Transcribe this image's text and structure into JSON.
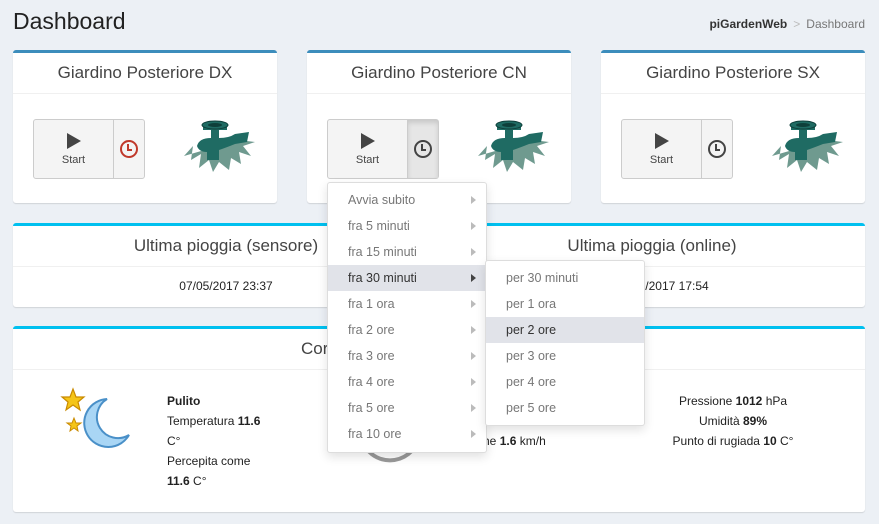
{
  "header": {
    "title": "Dashboard",
    "breadcrumb_home": "piGardenWeb",
    "breadcrumb_sep": ">",
    "breadcrumb_current": "Dashboard"
  },
  "zones": [
    {
      "title": "Giardino Posteriore DX",
      "start_label": "Start"
    },
    {
      "title": "Giardino Posteriore CN",
      "start_label": "Start"
    },
    {
      "title": "Giardino Posteriore SX",
      "start_label": "Start"
    }
  ],
  "rain": {
    "sensor_title": "Ultima pioggia (sensore)",
    "sensor_value": "07/05/2017 23:37",
    "online_title": "Ultima pioggia (online)",
    "online_value_partial": "/2017 17:54"
  },
  "weather": {
    "title_partial": "Cor",
    "condition": "Pulito",
    "temp_label": "Temperatura",
    "temp_value": "11.6",
    "temp_unit": "C°",
    "feels_label": "Percepita come",
    "feels_value": "11.6",
    "feels_unit": "C°",
    "wind_partial": "he",
    "wind_value": "1.6",
    "wind_unit": "km/h",
    "pressure_label": "Pressione",
    "pressure_value": "1012",
    "pressure_unit": "hPa",
    "humidity_label": "Umidità",
    "humidity_value": "89%",
    "dew_label": "Punto di rugiada",
    "dew_value": "10",
    "dew_unit": "C°"
  },
  "menu": {
    "items": [
      "Avvia subito",
      "fra 5 minuti",
      "fra 15 minuti",
      "fra 30 minuti",
      "fra 1 ora",
      "fra 2 ore",
      "fra 3 ore",
      "fra 4 ore",
      "fra 5 ore",
      "fra 10 ore"
    ],
    "submenu": [
      "per 30 minuti",
      "per 1 ora",
      "per 2 ore",
      "per 3 ore",
      "per 4 ore",
      "per 5 ore"
    ]
  },
  "colors": {
    "primary": "#3c8dbc",
    "info": "#00c0ef",
    "valve": "#1f6b63",
    "clock_red": "#c0392b"
  }
}
